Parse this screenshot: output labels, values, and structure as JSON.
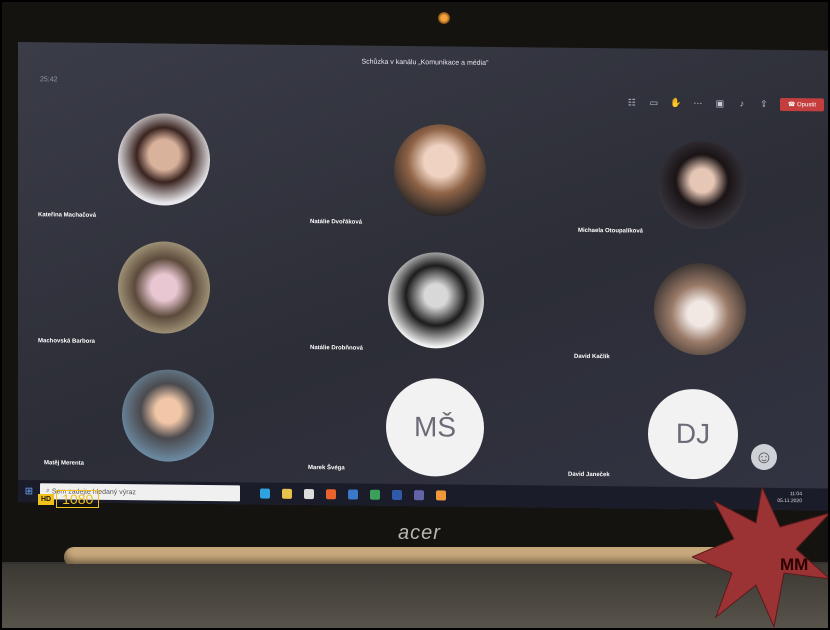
{
  "meeting": {
    "title": "Schůzka v kanálu „Komunikace a média\"",
    "timer": "25:42",
    "leave_label": "Opustit"
  },
  "participants": [
    {
      "name": "Kateřina Machačová",
      "kind": "photo"
    },
    {
      "name": "Natálie Dvořáková",
      "kind": "photo"
    },
    {
      "name": "Michaela Otoupalíková",
      "kind": "photo"
    },
    {
      "name": "Machovská Barbora",
      "kind": "photo"
    },
    {
      "name": "Natálie Drobňnová",
      "kind": "photo"
    },
    {
      "name": "David Kačlík",
      "kind": "photo"
    },
    {
      "name": "Matěj Merenta",
      "kind": "photo"
    },
    {
      "name": "Marek Švéga",
      "kind": "initials",
      "initials": "MŠ"
    },
    {
      "name": "David Janeček",
      "kind": "initials",
      "initials": "DJ"
    }
  ],
  "taskbar": {
    "search_placeholder": "Sem zadejte hledaný výraz",
    "time": "11:04",
    "date": "05.11.2020"
  },
  "laptop": {
    "hd_badge": "HD",
    "resolution": "1080",
    "brand": "acer"
  },
  "overlay": {
    "star_text": "MM",
    "star_color": "#9b3234"
  },
  "icons": [
    "windows-start-icon",
    "search-icon",
    "camera-icon",
    "mic-icon",
    "share-icon",
    "phone-icon",
    "emoji-icon"
  ]
}
